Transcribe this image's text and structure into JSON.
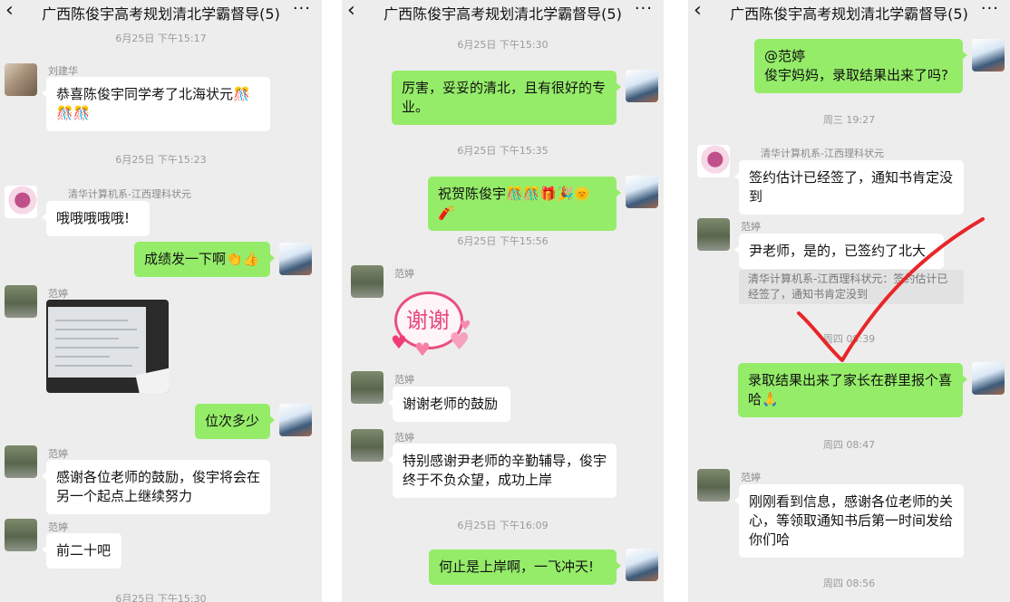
{
  "chat_title": "广西陈俊宇高考规划清北学霸督导(5)",
  "back_glyph": "‹",
  "more_glyph": "···",
  "panel1": {
    "ts1": "6月25日 下午15:17",
    "m1_name": "刘建华",
    "m1_text": "恭喜陈俊宇同学考了北海状元🎊🎊🎊",
    "ts2": "6月25日 下午15:23",
    "m2_name": "清华计算机系-江西理科状元",
    "m2_text": "哦哦哦哦哦!",
    "m3_text": "成绩发一下啊👏👍",
    "m4_name": "范婷",
    "m5_text": "位次多少",
    "m6_name": "范婷",
    "m6_text": "感谢各位老师的鼓励，俊宇将会在另一个起点上继续努力",
    "m7_name": "范婷",
    "m7_text": "前二十吧",
    "ts3": "6月25日 下午15:30"
  },
  "panel2": {
    "ts1": "6月25日 下午15:30",
    "m1_text": "厉害，妥妥的清北，且有很好的专业。",
    "ts2": "6月25日 下午15:35",
    "m2_text": "祝贺陈俊宇🎊🎊🎁🎉🌞🧨",
    "ts3": "6月25日 下午15:56",
    "m3_name": "范婷",
    "m3_sticker_text": "谢谢",
    "m4_name": "范婷",
    "m4_text": "谢谢老师的鼓励",
    "m5_name": "范婷",
    "m5_text": "特别感谢尹老师的辛勤辅导，俊宇终于不负众望，成功上岸",
    "ts4": "6月25日 下午16:09",
    "m6_text": "何止是上岸啊，一飞冲天!"
  },
  "panel3": {
    "m1_text": "@范婷\n俊宇妈妈，录取结果出来了吗?",
    "ts1": "周三 19:27",
    "m2_name": "清华计算机系-江西理科状元",
    "m2_text": "签约估计已经签了，通知书肯定没到",
    "m3_name": "范婷",
    "m3_text": "尹老师，是的，已签约了北大",
    "m3_quote": "清华计算机系-江西理科状元：签约估计已经签了，通知书肯定没到",
    "ts2": "周四 08:39",
    "m4_text": "录取结果出来了家长在群里报个喜哈🙏",
    "ts3": "周四 08:47",
    "m5_name": "范婷",
    "m5_text": "刚刚看到信息，感谢各位老师的关心，等领取通知书后第一时间发给你们哈",
    "ts4": "周四 08:56"
  },
  "colors": {
    "sent_bubble": "#95ec69",
    "received_bubble": "#ffffff",
    "background": "#ededed",
    "checkmark": "#e8262a"
  },
  "icons": [
    "back-chevron-icon",
    "more-dots-icon",
    "user-avatar",
    "checkmark-annotation"
  ]
}
